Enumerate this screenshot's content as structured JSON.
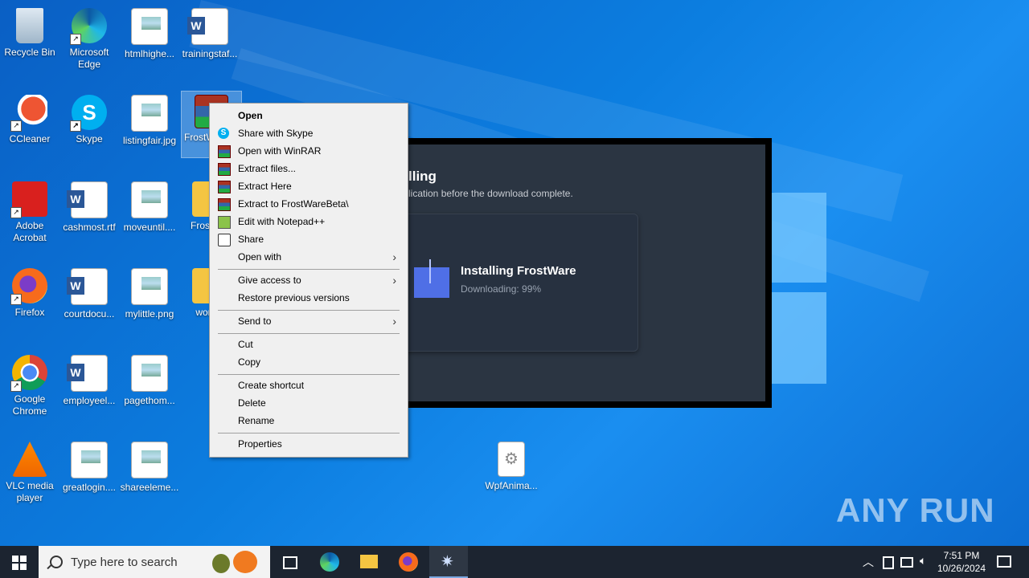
{
  "desktop": {
    "icons": [
      {
        "label": "Recycle Bin"
      },
      {
        "label": "Microsoft Edge"
      },
      {
        "label": "htmlhighe..."
      },
      {
        "label": "trainingstaf..."
      },
      {
        "label": "CCleaner"
      },
      {
        "label": "Skype"
      },
      {
        "label": "listingfair.jpg"
      },
      {
        "label": "FrostW... a..."
      },
      {
        "label": "Adobe Acrobat"
      },
      {
        "label": "cashmost.rtf"
      },
      {
        "label": "moveuntil...."
      },
      {
        "label": "FrostW..."
      },
      {
        "label": "Firefox"
      },
      {
        "label": "courtdocu..."
      },
      {
        "label": "mylittle.png"
      },
      {
        "label": "work..."
      },
      {
        "label": "Google Chrome"
      },
      {
        "label": "employeel..."
      },
      {
        "label": "pagethom..."
      },
      {
        "label": "VLC media player"
      },
      {
        "label": "greatlogin...."
      },
      {
        "label": "shareeleme..."
      },
      {
        "label": "WpfAnima..."
      }
    ]
  },
  "installer": {
    "title": "lling",
    "subtitle": "lication before the download complete.",
    "card_title": "Installing FrostWare",
    "card_status": "Downloading: 99%"
  },
  "context_menu": {
    "items": [
      {
        "label": "Open"
      },
      {
        "label": "Share with Skype"
      },
      {
        "label": "Open with WinRAR"
      },
      {
        "label": "Extract files..."
      },
      {
        "label": "Extract Here"
      },
      {
        "label": "Extract to FrostWareBeta\\"
      },
      {
        "label": "Edit with Notepad++"
      },
      {
        "label": "Share"
      },
      {
        "label": "Open with"
      },
      {
        "label": "Give access to"
      },
      {
        "label": "Restore previous versions"
      },
      {
        "label": "Send to"
      },
      {
        "label": "Cut"
      },
      {
        "label": "Copy"
      },
      {
        "label": "Create shortcut"
      },
      {
        "label": "Delete"
      },
      {
        "label": "Rename"
      },
      {
        "label": "Properties"
      }
    ]
  },
  "watermark": "ANY RUN",
  "taskbar": {
    "search_placeholder": "Type here to search",
    "time": "7:51 PM",
    "date": "10/26/2024"
  }
}
